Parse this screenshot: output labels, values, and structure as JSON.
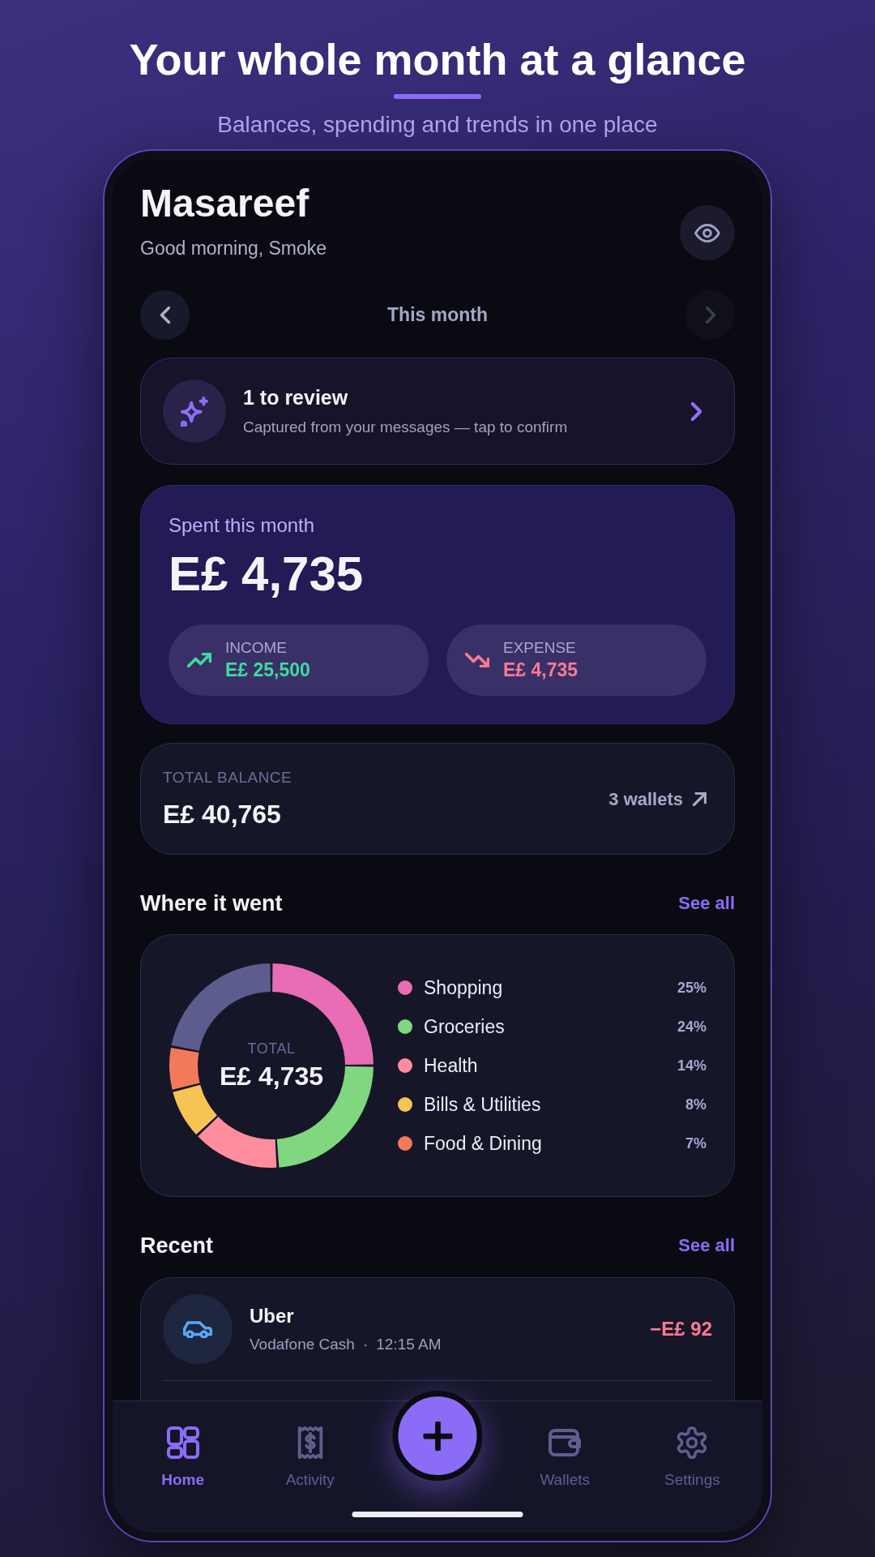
{
  "promo": {
    "headline": "Your whole month at a glance",
    "subtitle": "Balances, spending and trends in one place"
  },
  "header": {
    "app_name": "Masareef",
    "greeting": "Good morning, Smoke"
  },
  "period": {
    "label": "This month",
    "previous": {
      "disabled": false
    },
    "next": {
      "disabled": true
    }
  },
  "review_card": {
    "title": "1 to review",
    "subtitle": "Captured from your messages — tap to confirm"
  },
  "spent_card": {
    "label": "Spent this month",
    "amount": "E£ 4,735",
    "stats": [
      {
        "kind": "income",
        "label": "INCOME",
        "amount": "E£ 25,500"
      },
      {
        "kind": "expense",
        "label": "EXPENSE",
        "amount": "E£ 4,735"
      }
    ]
  },
  "balance_card": {
    "label": "TOTAL BALANCE",
    "amount": "E£ 40,765",
    "wallets": "3 wallets"
  },
  "breakdown": {
    "title": "Where it went",
    "link": "See all",
    "center_label": "TOTAL",
    "center_value": "E£ 4,735",
    "chart_data": {
      "type": "donut",
      "categories": [
        "Shopping",
        "Groceries",
        "Health",
        "Bills & Utilities",
        "Food & Dining",
        null
      ],
      "values": [
        25,
        24,
        14,
        8,
        7,
        22
      ]
    },
    "legend": [
      {
        "percent": "25%",
        "color": "#e86db5"
      },
      {
        "percent": "24%",
        "color": "#7fd87f"
      },
      {
        "percent": "14%",
        "color": "#ff8d9e"
      },
      {
        "percent": "8%",
        "color": "#f6c452"
      },
      {
        "percent": "7%",
        "color": "#f27a5a"
      }
    ]
  },
  "recent": {
    "title": "Recent",
    "link": "See all",
    "transactions": [
      {
        "name": "Uber",
        "wallet": "Vodafone Cash",
        "separator": "·",
        "time": "12:15 AM",
        "amount": "−E£ 92"
      }
    ]
  },
  "bottom_nav": {
    "items": [
      {
        "label": "Home",
        "selected": true
      },
      {
        "label": "Activity",
        "selected": false
      },
      {
        "label": "Wallets",
        "selected": false
      },
      {
        "label": "Settings",
        "selected": false
      }
    ]
  }
}
